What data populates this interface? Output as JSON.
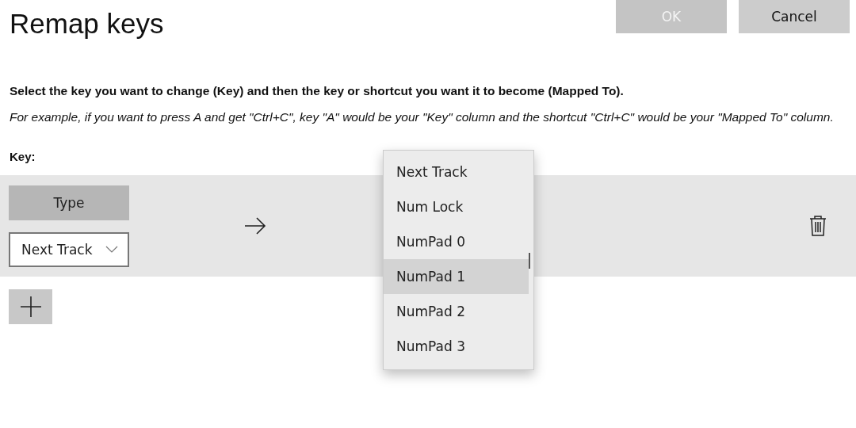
{
  "title": "Remap keys",
  "buttons": [
    {
      "label": "OK",
      "disabled": true
    },
    {
      "label": "Cancel",
      "disabled": false
    }
  ],
  "instructions": "Select the key you want to change (Key) and then the key or shortcut you want it to become (Mapped To).",
  "example": "For example, if you want to press A and get \"Ctrl+C\", key \"A\" would be your \"Key\" column and the shortcut \"Ctrl+C\" would be your \"Mapped To\" column.",
  "key_label": "Key:",
  "mapping": {
    "type_button": "Type",
    "key_value": "Next Track"
  },
  "dropdown": {
    "items": [
      {
        "label": "Next Track",
        "selected": false
      },
      {
        "label": "Num Lock",
        "selected": false
      },
      {
        "label": "NumPad 0",
        "selected": false
      },
      {
        "label": "NumPad 1",
        "selected": true
      },
      {
        "label": "NumPad 2",
        "selected": false
      },
      {
        "label": "NumPad 3",
        "selected": false
      }
    ]
  }
}
